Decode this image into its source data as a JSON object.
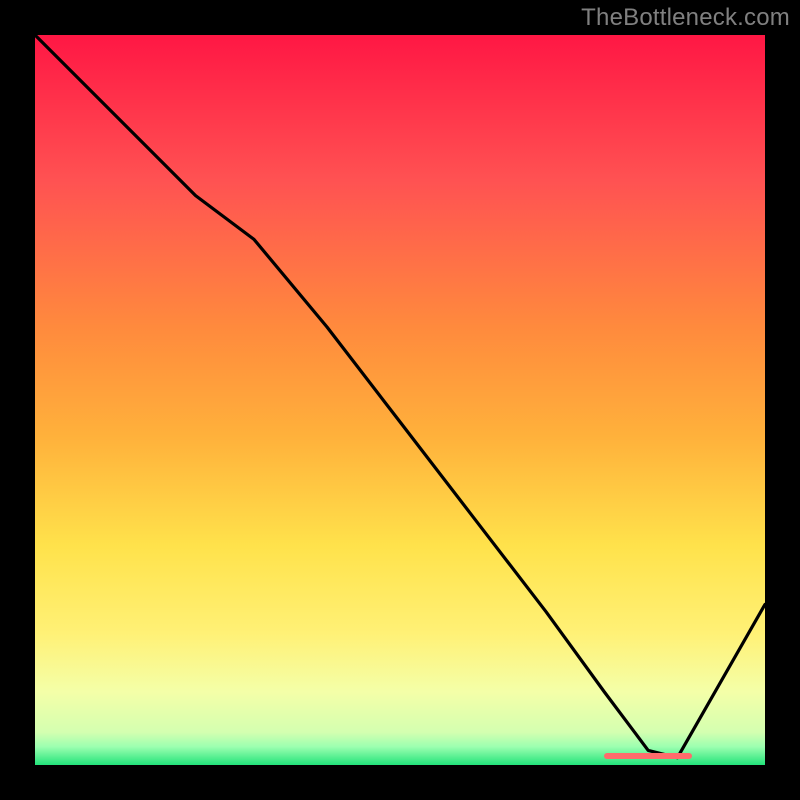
{
  "watermark": "TheBottleneck.com",
  "chart_data": {
    "type": "line",
    "title": "",
    "xlabel": "",
    "ylabel": "",
    "xlim": [
      0,
      100
    ],
    "ylim": [
      0,
      100
    ],
    "x": [
      0,
      10,
      22,
      30,
      40,
      50,
      60,
      70,
      78,
      84,
      88,
      100
    ],
    "values": [
      100,
      90,
      78,
      72,
      60,
      47,
      34,
      21,
      10,
      2,
      1,
      22
    ],
    "gradient_stops": [
      {
        "offset": 0.0,
        "color": "#ff1744"
      },
      {
        "offset": 0.2,
        "color": "#ff5252"
      },
      {
        "offset": 0.4,
        "color": "#ff8a3d"
      },
      {
        "offset": 0.55,
        "color": "#ffb13b"
      },
      {
        "offset": 0.7,
        "color": "#ffe24b"
      },
      {
        "offset": 0.82,
        "color": "#fff176"
      },
      {
        "offset": 0.9,
        "color": "#f4ffa8"
      },
      {
        "offset": 0.955,
        "color": "#d4ffb0"
      },
      {
        "offset": 0.975,
        "color": "#9cffb0"
      },
      {
        "offset": 1.0,
        "color": "#22e37a"
      }
    ],
    "optimal_band": {
      "x_start": 78,
      "x_end": 90
    }
  },
  "colors": {
    "background": "#000000",
    "line": "#000000",
    "watermark": "#808080",
    "band": "#ff6b6b"
  }
}
